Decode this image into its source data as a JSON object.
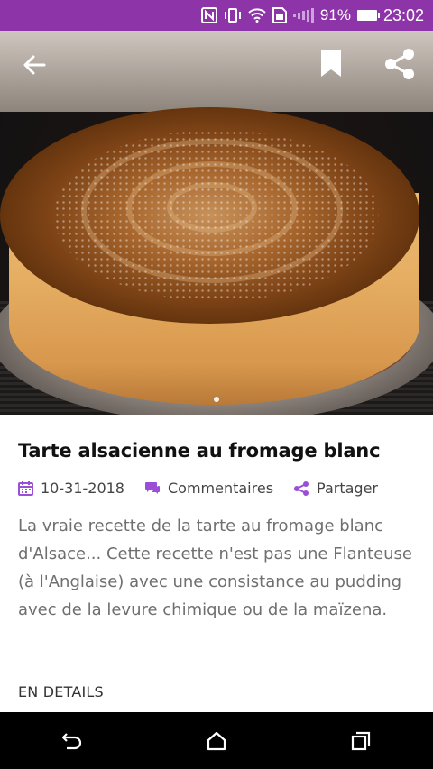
{
  "status_bar": {
    "battery_percent": "91%",
    "time": "23:02",
    "color": "#8e34a9",
    "icons": [
      "nfc-icon",
      "vibrate-icon",
      "wifi-icon",
      "sim-icon",
      "signal-icon",
      "battery-icon"
    ]
  },
  "hero": {
    "icons": [
      "back-arrow-icon",
      "bookmark-icon",
      "share-icon"
    ],
    "carousel_pages": 1
  },
  "article": {
    "title": "Tarte alsacienne au fromage blanc",
    "date": "10-31-2018",
    "comments_label": "Commentaires",
    "share_label": "Partager",
    "description": "La vraie recette de la tarte au fromage blanc d'Alsace... Cette recette n'est pas une Flanteuse (à l'Anglaise) avec une consistance au pudding avec de la levure chimique ou de la maïzena.",
    "details_label": "EN DETAILS",
    "accent_color": "#9b4fd6"
  },
  "nav_bar": {
    "icons": [
      "back-icon",
      "home-icon",
      "recents-icon"
    ]
  }
}
